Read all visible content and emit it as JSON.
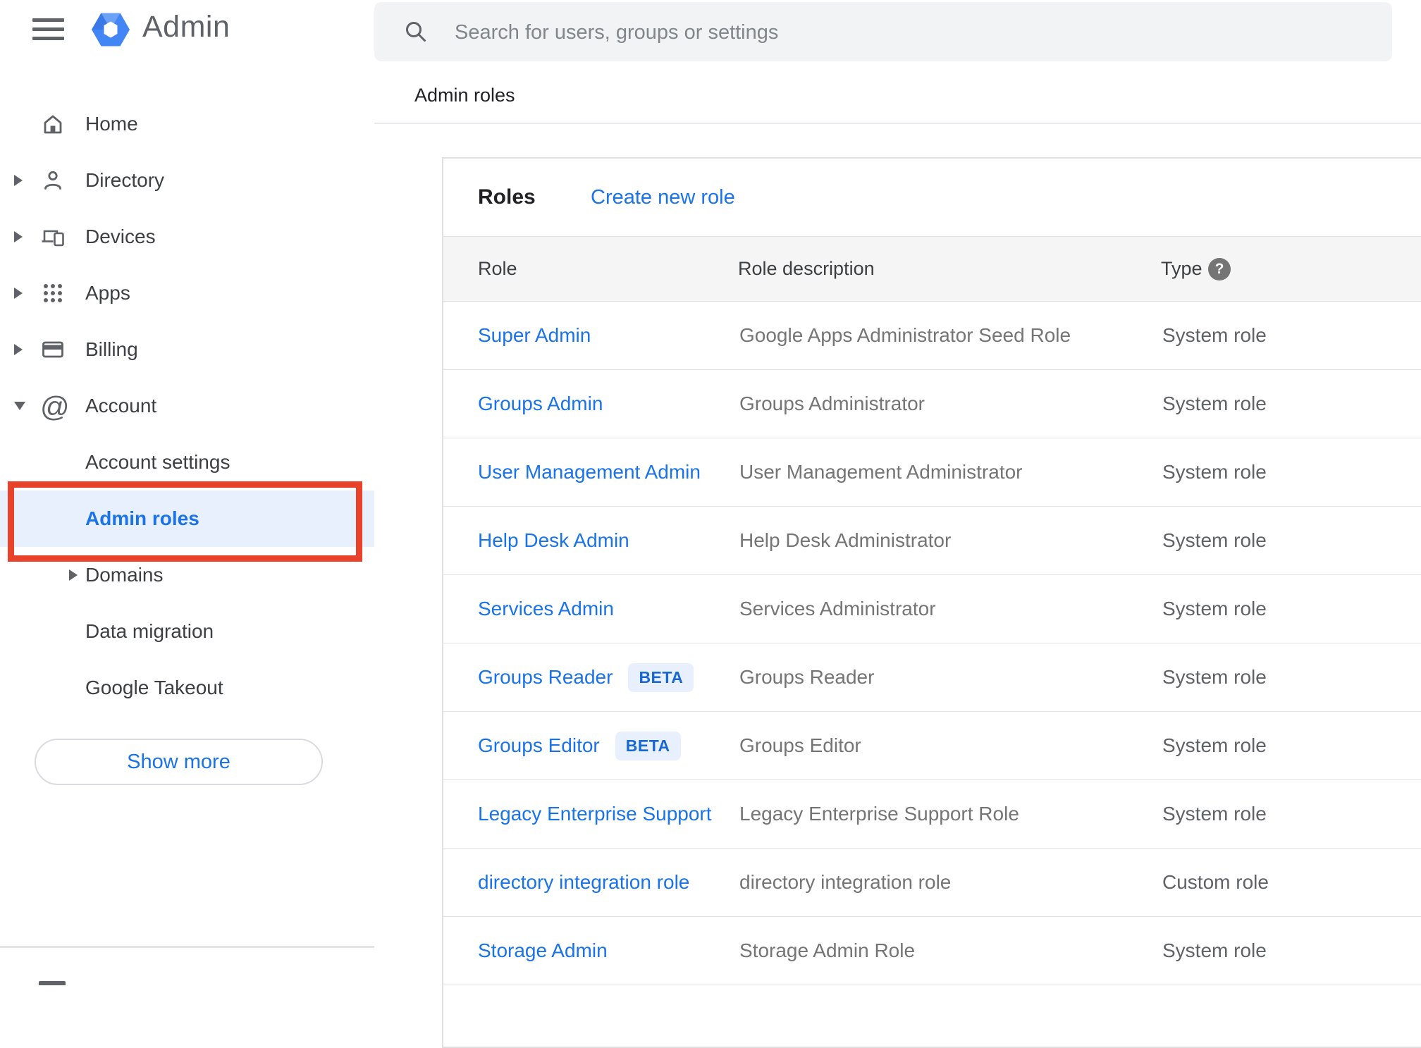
{
  "app": {
    "name": "Admin",
    "menu_icon": "menu-icon",
    "logo_icon": "admin-hexagon-logo"
  },
  "search": {
    "placeholder": "Search for users, groups or settings",
    "icon": "search-icon"
  },
  "breadcrumb": "Admin roles",
  "sidebar": {
    "items": [
      {
        "label": "Home",
        "icon": "home-icon",
        "caret": null,
        "level": 0,
        "selected": false
      },
      {
        "label": "Directory",
        "icon": "person-icon",
        "caret": "right",
        "level": 0,
        "selected": false
      },
      {
        "label": "Devices",
        "icon": "devices-icon",
        "caret": "right",
        "level": 0,
        "selected": false
      },
      {
        "label": "Apps",
        "icon": "apps-grid-icon",
        "caret": "right",
        "level": 0,
        "selected": false
      },
      {
        "label": "Billing",
        "icon": "credit-card-icon",
        "caret": "right",
        "level": 0,
        "selected": false
      },
      {
        "label": "Account",
        "icon": "at-sign-icon",
        "caret": "down",
        "level": 0,
        "selected": false
      },
      {
        "label": "Account settings",
        "icon": null,
        "caret": null,
        "level": 1,
        "selected": false
      },
      {
        "label": "Admin roles",
        "icon": null,
        "caret": null,
        "level": 1,
        "selected": true
      },
      {
        "label": "Domains",
        "icon": null,
        "caret": "right",
        "level": 1,
        "selected": false
      },
      {
        "label": "Data migration",
        "icon": null,
        "caret": null,
        "level": 1,
        "selected": false
      },
      {
        "label": "Google Takeout",
        "icon": null,
        "caret": null,
        "level": 1,
        "selected": false
      }
    ],
    "show_more_label": "Show more"
  },
  "roles_card": {
    "title": "Roles",
    "create_link": "Create new role",
    "columns": [
      "Role",
      "Role description",
      "Type"
    ],
    "type_help_icon": "help-icon",
    "beta_label": "BETA",
    "rows": [
      {
        "role": "Super Admin",
        "beta": false,
        "description": "Google Apps Administrator Seed Role",
        "type": "System role"
      },
      {
        "role": "Groups Admin",
        "beta": false,
        "description": "Groups Administrator",
        "type": "System role"
      },
      {
        "role": "User Management Admin",
        "beta": false,
        "description": "User Management Administrator",
        "type": "System role"
      },
      {
        "role": "Help Desk Admin",
        "beta": false,
        "description": "Help Desk Administrator",
        "type": "System role"
      },
      {
        "role": "Services Admin",
        "beta": false,
        "description": "Services Administrator",
        "type": "System role"
      },
      {
        "role": "Groups Reader",
        "beta": true,
        "description": "Groups Reader",
        "type": "System role"
      },
      {
        "role": "Groups Editor",
        "beta": true,
        "description": "Groups Editor",
        "type": "System role"
      },
      {
        "role": "Legacy Enterprise Support",
        "beta": false,
        "description": "Legacy Enterprise Support Role",
        "type": "System role"
      },
      {
        "role": "directory integration role",
        "beta": false,
        "description": "directory integration role",
        "type": "Custom role"
      },
      {
        "role": "Storage Admin",
        "beta": false,
        "description": "Storage Admin Role",
        "type": "System role"
      }
    ]
  },
  "colors": {
    "accent": "#1a73e8",
    "selected-bg": "#e8f0fe",
    "annotation": "#e8432a",
    "beta-bg": "#e8f0fe",
    "beta-text": "#1967d2"
  }
}
